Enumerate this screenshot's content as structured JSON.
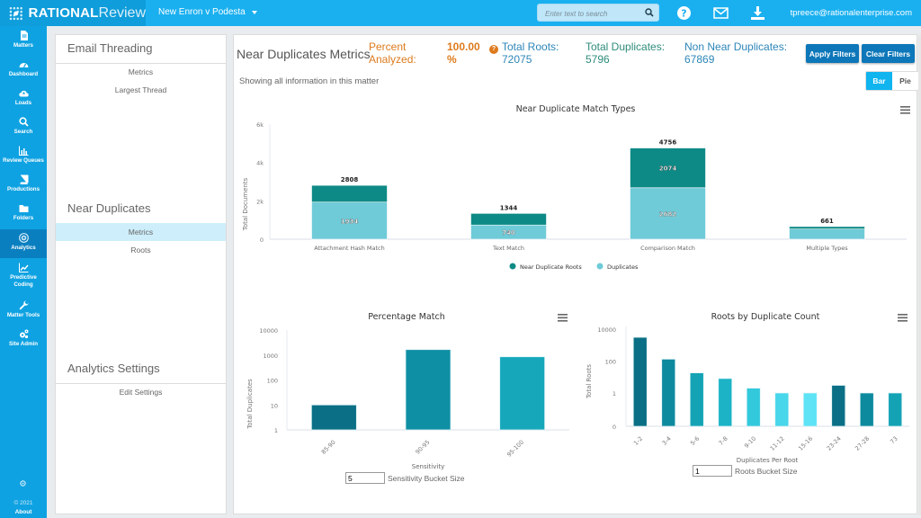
{
  "topbar": {
    "brand_bold": "RATIONAL",
    "brand_light": "Review",
    "matter_name": "New Enron v Podesta",
    "search_placeholder": "Enter text to search",
    "user_email": "tpreece@rationalenterprise.com",
    "colors": {
      "bar": "#1ab0f0",
      "brand_bg": "#0f9ddb"
    }
  },
  "sidenav": {
    "items": [
      {
        "label": "Matters",
        "icon": "document-icon"
      },
      {
        "label": "Dashboard",
        "icon": "dashboard-gauge-icon"
      },
      {
        "label": "Loads",
        "icon": "cloud-upload-icon"
      },
      {
        "label": "Search",
        "icon": "search-icon"
      },
      {
        "label": "Review Queues",
        "icon": "bar-chart-icon"
      },
      {
        "label": "Productions",
        "icon": "book-icon"
      },
      {
        "label": "Folders",
        "icon": "folder-icon"
      },
      {
        "label": "Analytics",
        "icon": "target-icon",
        "active": true
      },
      {
        "label": "Predictive",
        "label2": "Coding",
        "icon": "line-chart-icon"
      },
      {
        "label": "Matter Tools",
        "icon": "wrench-icon"
      },
      {
        "label": "Site Admin",
        "icon": "gears-icon"
      }
    ],
    "footer_copyright": "© 2021",
    "footer_about": "About"
  },
  "leftpanel": {
    "sections": [
      {
        "heading": "Email Threading",
        "items": [
          "Metrics",
          "Largest Thread"
        ]
      },
      {
        "heading": "Near Duplicates",
        "items": [
          "Metrics",
          "Roots"
        ],
        "active_item": "Metrics"
      },
      {
        "heading": "Analytics Settings",
        "items": [
          "Edit Settings"
        ]
      }
    ]
  },
  "main": {
    "title": "Near Duplicates Metrics",
    "percent_label_1": "Percent",
    "percent_label_2": "Analyzed:",
    "percent_value_1": "100.00",
    "percent_value_2": "%",
    "help_glyph": "?",
    "total_roots_label": "Total Roots:",
    "total_roots_value": "72075",
    "total_duplicates_label": "Total Duplicates:",
    "total_duplicates_value": "5796",
    "non_near_label": "Non Near Duplicates:",
    "non_near_value": "67869",
    "apply_filters": "Apply Filters",
    "clear_filters": "Clear Filters",
    "subtitle": "Showing all information in this matter",
    "view_toggle": {
      "bar": "Bar",
      "pie": "Pie",
      "selected": "Bar"
    },
    "sensitivity_bucket_value": "5",
    "sensitivity_bucket_label": "Sensitivity Bucket Size",
    "roots_bucket_value": "1",
    "roots_bucket_label": "Roots Bucket Size"
  },
  "chart_data": [
    {
      "type": "bar",
      "stacked": true,
      "title": "Near Duplicate Match Types",
      "xlabel": "",
      "ylabel": "Total Documents",
      "ylim": [
        0,
        6000
      ],
      "yticks": [
        "0",
        "2k",
        "4k",
        "6k"
      ],
      "categories": [
        "Attachment Hash Match",
        "Text Match",
        "Comparison Match",
        "Multiple Types"
      ],
      "totals": [
        2808,
        1344,
        4756,
        661
      ],
      "series": [
        {
          "name": "Near Duplicate Roots",
          "color": "#0e8a86",
          "values": [
            874,
            604,
            2074,
            130
          ],
          "labels": [
            null,
            null,
            "2074",
            null
          ]
        },
        {
          "name": "Duplicates",
          "color": "#6fcbd8",
          "values": [
            1934,
            740,
            2682,
            531
          ],
          "labels": [
            "1934",
            "740",
            "2682",
            null
          ]
        }
      ],
      "legend": "bottom",
      "grid": false
    },
    {
      "type": "bar",
      "title": "Percentage Match",
      "xlabel": "Sensitivity",
      "ylabel": "Total Duplicates",
      "yscale": "log",
      "ylim": [
        1,
        10000
      ],
      "yticks": [
        "1",
        "10",
        "100",
        "1000",
        "10000"
      ],
      "categories": [
        "85-90",
        "90-95",
        "95-100"
      ],
      "values": [
        10,
        1650,
        850
      ],
      "colors": [
        "#0b6f85",
        "#0f8fa3",
        "#16a7bb"
      ],
      "grid": false
    },
    {
      "type": "bar",
      "title": "Roots by Duplicate Count",
      "xlabel": "Duplicates Per Root",
      "ylabel": "Total Roots",
      "yscale": "log",
      "yticks": [
        "0",
        "1",
        "100",
        "10000"
      ],
      "categories": [
        "1-2",
        "3-4",
        "5-6",
        "7-8",
        "9-10",
        "11-12",
        "15-16",
        "23-24",
        "27-28",
        "73"
      ],
      "values": [
        3000,
        130,
        18,
        8,
        2,
        1,
        1,
        3,
        1,
        1
      ],
      "colors": [
        "#0b6f85",
        "#0e8a9e",
        "#14a3b5",
        "#1cb3c6",
        "#33c9dd",
        "#48d6ea",
        "#5de3f5",
        "#0b6f85",
        "#0e8a9e",
        "#14a3b5"
      ],
      "grid": false
    }
  ]
}
